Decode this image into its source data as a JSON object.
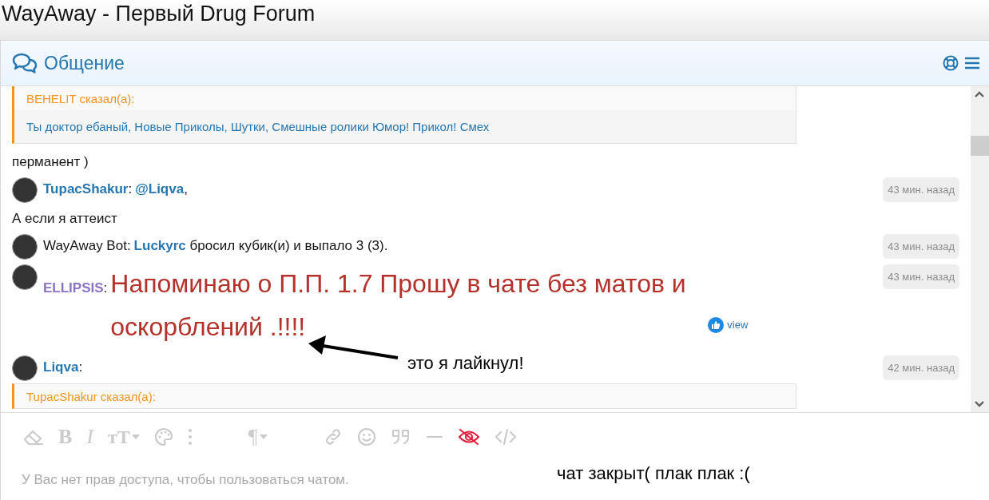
{
  "page_title": "WayAway - Первый Drug Forum",
  "chat": {
    "title": "Общение",
    "messages": [
      {
        "kind": "quote",
        "header": "BEHELIT сказал(а):",
        "body": "Ты доктор ебаный, Новые Приколы, Шутки, Смешные ролики Юмор! Прикол! Смех"
      },
      {
        "kind": "text",
        "text": "перманент )"
      },
      {
        "kind": "message",
        "user": "TupacShakur",
        "color": "#2577b1",
        "separator": ":",
        "content": "**@Liqva**,",
        "time": "43 мин. назад"
      },
      {
        "kind": "text",
        "text": "А если я аттеист"
      },
      {
        "kind": "bot-message",
        "user": "WayAway Bot",
        "color": "#141414",
        "separator": ":",
        "content": "**Luckyrc** бросил кубик(и) и выпало 3 (3).",
        "time": "43 мин. назад"
      },
      {
        "kind": "announcement",
        "user": "ELLIPSIS",
        "color": "#8a72c4",
        "separator": ":",
        "content": "Напоминаю о П.П. 1.7 Прошу в чате без матов и оскорблений .!!!!",
        "liked": true,
        "reaction_link": "view",
        "time": "43 мин. назад"
      },
      {
        "kind": "message",
        "user": "Liqva",
        "color": "#2577b1",
        "separator": ":",
        "time": "42 мин. назад"
      },
      {
        "kind": "quote",
        "header": "TupacShakur сказал(а):"
      }
    ],
    "toolbar": [
      [
        {
          "kind": "eraser"
        },
        {
          "kind": "bold",
          "glyph": "B"
        },
        {
          "kind": "italic",
          "glyph": "I"
        },
        {
          "kind": "size",
          "glyph": "тT",
          "caret": true
        },
        {
          "kind": "palette"
        },
        {
          "kind": "more"
        }
      ],
      [
        {
          "kind": "paragraph",
          "glyph": "¶",
          "caret": true
        }
      ],
      [
        {
          "kind": "link"
        },
        {
          "kind": "smile"
        },
        {
          "kind": "quote"
        },
        {
          "kind": "rule"
        },
        {
          "kind": "hide",
          "active": true
        },
        {
          "kind": "code"
        }
      ]
    ],
    "input_placeholder": "У Вас нет прав доступа, чтобы пользоваться чатом."
  },
  "annotations": [
    {
      "kind": "arrow-note",
      "text": "это я лайкнул!"
    },
    {
      "kind": "note",
      "text": "чат закрыт( плак плак :("
    }
  ]
}
